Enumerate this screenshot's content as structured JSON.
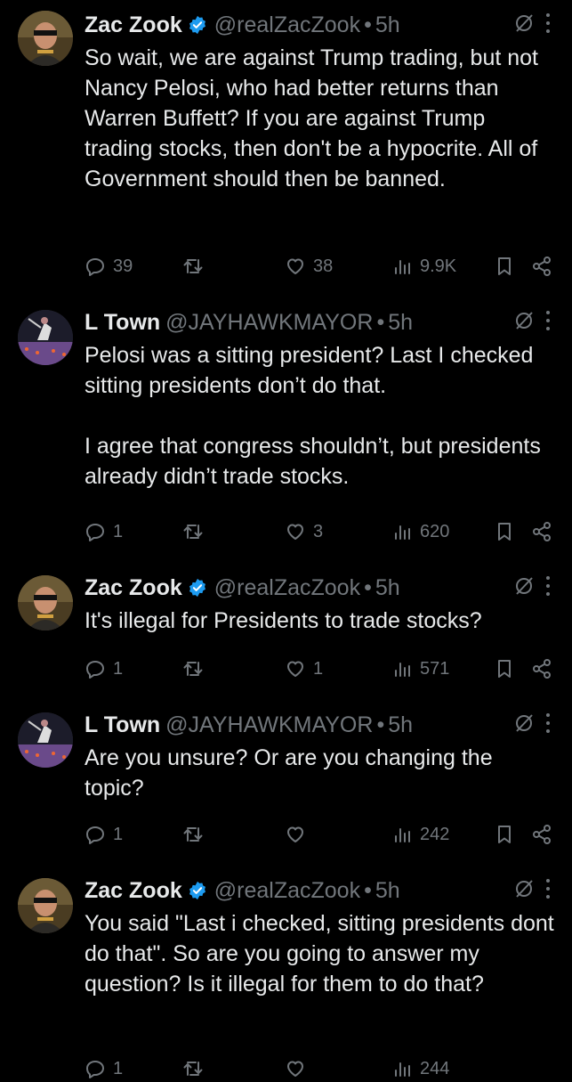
{
  "tweets": [
    {
      "avatar": "zac-zook-avatar",
      "name": "Zac Zook",
      "verified": true,
      "handle": "@realZacZook",
      "time": "5h",
      "text": "So wait, we are against Trump trading, but not Nancy Pelosi, who had better returns than Warren Buffett? If you are against Trump trading stocks, then don't be a hypocrite. All of Government should then be banned.",
      "replies": "39",
      "retweets": "",
      "likes": "38",
      "views": "9.9K"
    },
    {
      "avatar": "l-town-avatar",
      "name": "L Town",
      "verified": false,
      "handle": "@JAYHAWKMAYOR",
      "time": "5h",
      "text": "Pelosi was a sitting president? Last I checked sitting presidents don’t do that.\n\nI agree that congress shouldn’t, but presidents already didn’t trade stocks.",
      "replies": "1",
      "retweets": "",
      "likes": "3",
      "views": "620"
    },
    {
      "avatar": "zac-zook-avatar",
      "name": "Zac Zook",
      "verified": true,
      "handle": "@realZacZook",
      "time": "5h",
      "text": "It's illegal for Presidents to trade stocks?",
      "replies": "1",
      "retweets": "",
      "likes": "1",
      "views": "571"
    },
    {
      "avatar": "l-town-avatar",
      "name": "L Town",
      "verified": false,
      "handle": "@JAYHAWKMAYOR",
      "time": "5h",
      "text": "Are you unsure? Or are you changing the topic?",
      "replies": "1",
      "retweets": "",
      "likes": "",
      "views": "242"
    },
    {
      "avatar": "zac-zook-avatar",
      "name": "Zac Zook",
      "verified": true,
      "handle": "@realZacZook",
      "time": "5h",
      "text": "You said \"Last i checked, sitting presidents dont do that\". So are you going to answer my question? Is it illegal for them to do that?",
      "replies": "1",
      "retweets": "",
      "likes": "",
      "views": "244"
    }
  ],
  "separator": "•",
  "colors": {
    "background": "#000000",
    "text": "#e7e9ea",
    "secondary": "#71767b",
    "verified": "#1d9bf0"
  }
}
